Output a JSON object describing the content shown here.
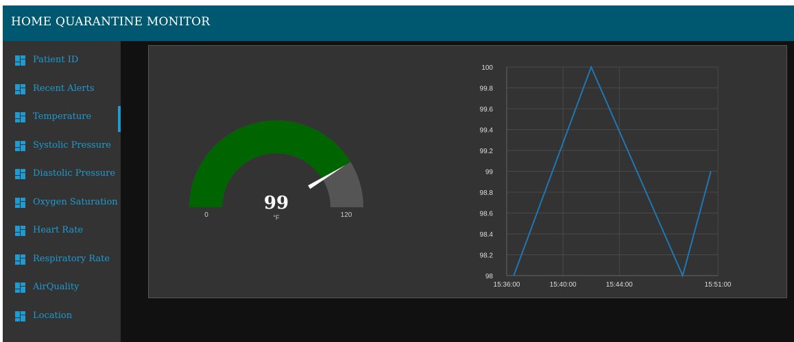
{
  "header": {
    "title": "HOME QUARANTINE MONITOR"
  },
  "sidebar": {
    "items": [
      {
        "label": "Patient ID",
        "icon": "dashboard-icon",
        "active": false
      },
      {
        "label": "Recent Alerts",
        "icon": "dashboard-icon",
        "active": false
      },
      {
        "label": "Temperature",
        "icon": "dashboard-icon",
        "active": true
      },
      {
        "label": "Systolic Pressure",
        "icon": "dashboard-icon",
        "active": false
      },
      {
        "label": "Diastolic Pressure",
        "icon": "dashboard-icon",
        "active": false
      },
      {
        "label": "Oxygen Saturation",
        "icon": "dashboard-icon",
        "active": false
      },
      {
        "label": "Heart Rate",
        "icon": "dashboard-icon",
        "active": false
      },
      {
        "label": "Respiratory Rate",
        "icon": "dashboard-icon",
        "active": false
      },
      {
        "label": "AirQuality",
        "icon": "dashboard-icon",
        "active": false
      },
      {
        "label": "Location",
        "icon": "dashboard-icon",
        "active": false
      }
    ]
  },
  "gauge": {
    "value": "99",
    "unit": "°F",
    "min_label": "0",
    "max_label": "120",
    "min": 0,
    "max": 120,
    "reading": 99,
    "fill_color": "#006400",
    "track_color": "#555555"
  },
  "chart_data": {
    "type": "line",
    "title": "",
    "xlabel": "",
    "ylabel": "",
    "x": [
      "15:36:30",
      "15:42:00",
      "15:48:30",
      "15:50:30"
    ],
    "series": [
      {
        "values": [
          98,
          100,
          98,
          99
        ],
        "color": "#1f77b4"
      }
    ],
    "ylim": [
      98,
      100
    ],
    "yticks": [
      "98",
      "98.2",
      "98.4",
      "98.6",
      "98.8",
      "99",
      "99.2",
      "99.4",
      "99.6",
      "99.8",
      "100"
    ],
    "xlim": [
      "15:36:00",
      "15:51:00"
    ],
    "xticks": [
      "15:36:00",
      "15:40:00",
      "15:44:00",
      "15:51:00"
    ],
    "grid": true
  },
  "colors": {
    "header_bg": "#005870",
    "sidebar_bg": "#333333",
    "accent": "#1e9bd1",
    "page_bg": "#111111"
  }
}
